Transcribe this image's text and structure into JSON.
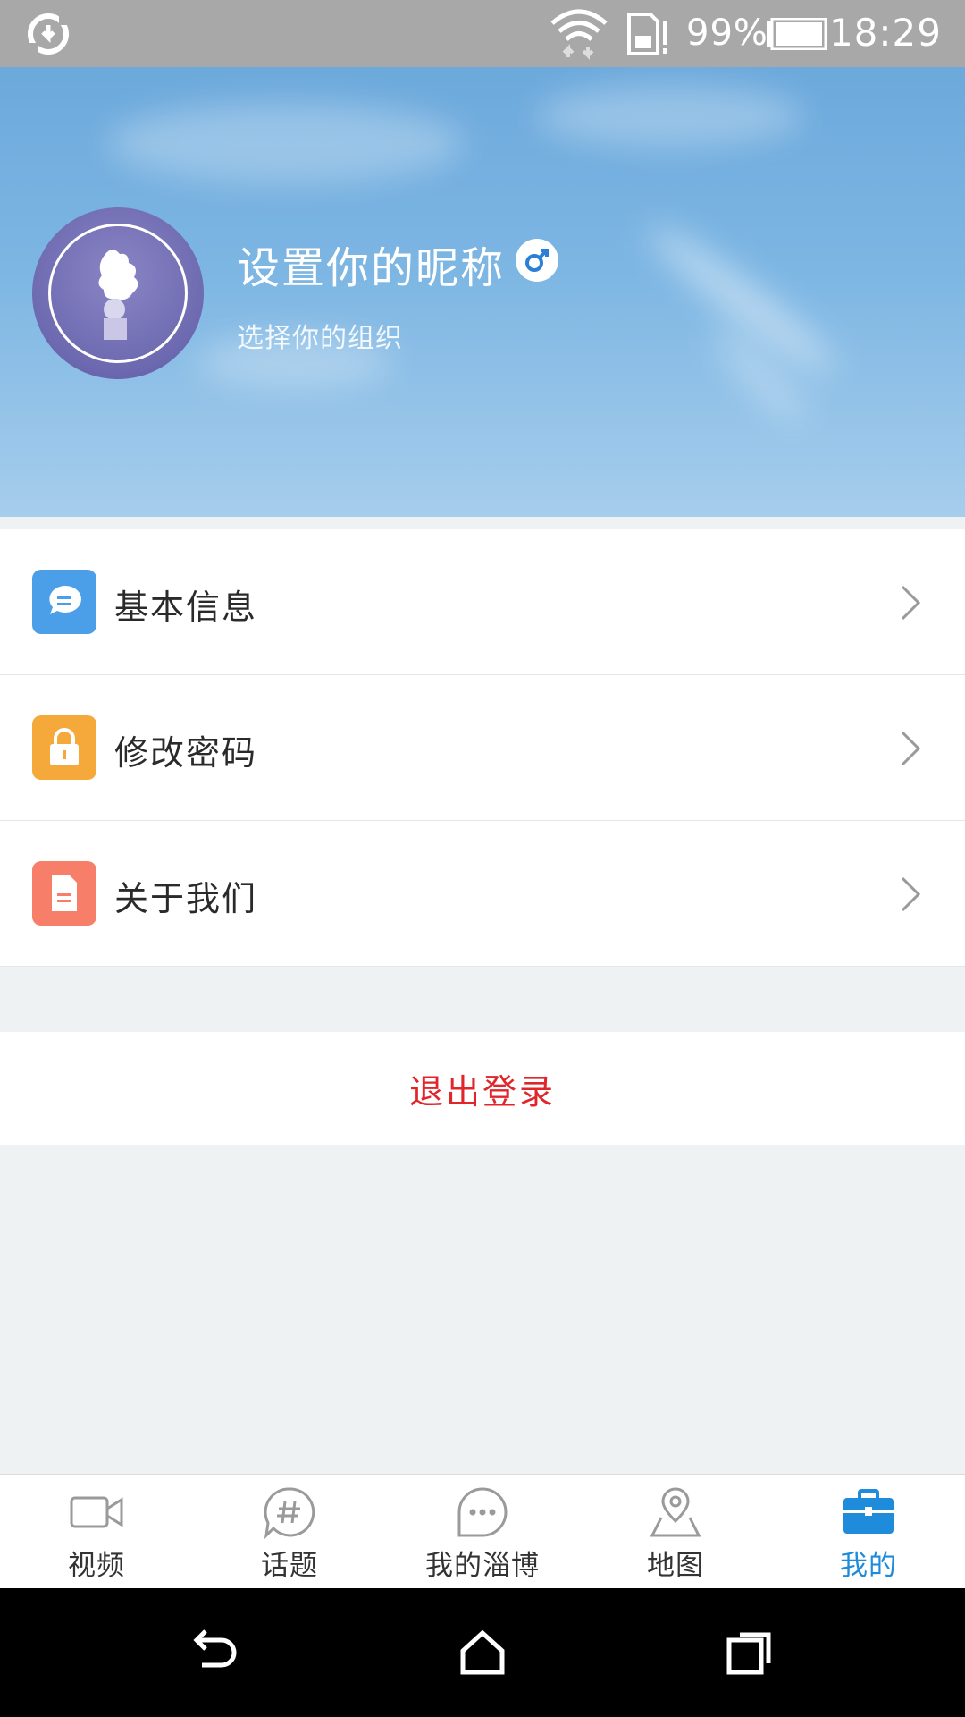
{
  "status_bar": {
    "battery_percent": "99%",
    "time": "18:29",
    "icons": [
      "sync-icon",
      "wifi-icon",
      "sim-alert-icon",
      "battery-icon"
    ]
  },
  "profile": {
    "nickname": "设置你的昵称",
    "organization": "选择你的组织",
    "gender_icon": "male-icon"
  },
  "menu": {
    "items": [
      {
        "label": "基本信息",
        "icon": "chat-bubble-icon",
        "color": "#4a9fe8"
      },
      {
        "label": "修改密码",
        "icon": "lock-icon",
        "color": "#f6a93b"
      },
      {
        "label": "关于我们",
        "icon": "document-icon",
        "color": "#f77e69"
      }
    ]
  },
  "logout": {
    "label": "退出登录",
    "color": "#e0262a"
  },
  "tabbar": {
    "active_color": "#1f8bdb",
    "tabs": [
      {
        "label": "视频",
        "icon": "video-icon"
      },
      {
        "label": "话题",
        "icon": "hashtag-icon"
      },
      {
        "label": "我的淄博",
        "icon": "chat-dots-icon"
      },
      {
        "label": "地图",
        "icon": "map-pin-icon"
      },
      {
        "label": "我的",
        "icon": "briefcase-icon",
        "active": true
      }
    ]
  },
  "navbar": {
    "icons": [
      "back-icon",
      "home-icon",
      "recents-icon"
    ]
  }
}
